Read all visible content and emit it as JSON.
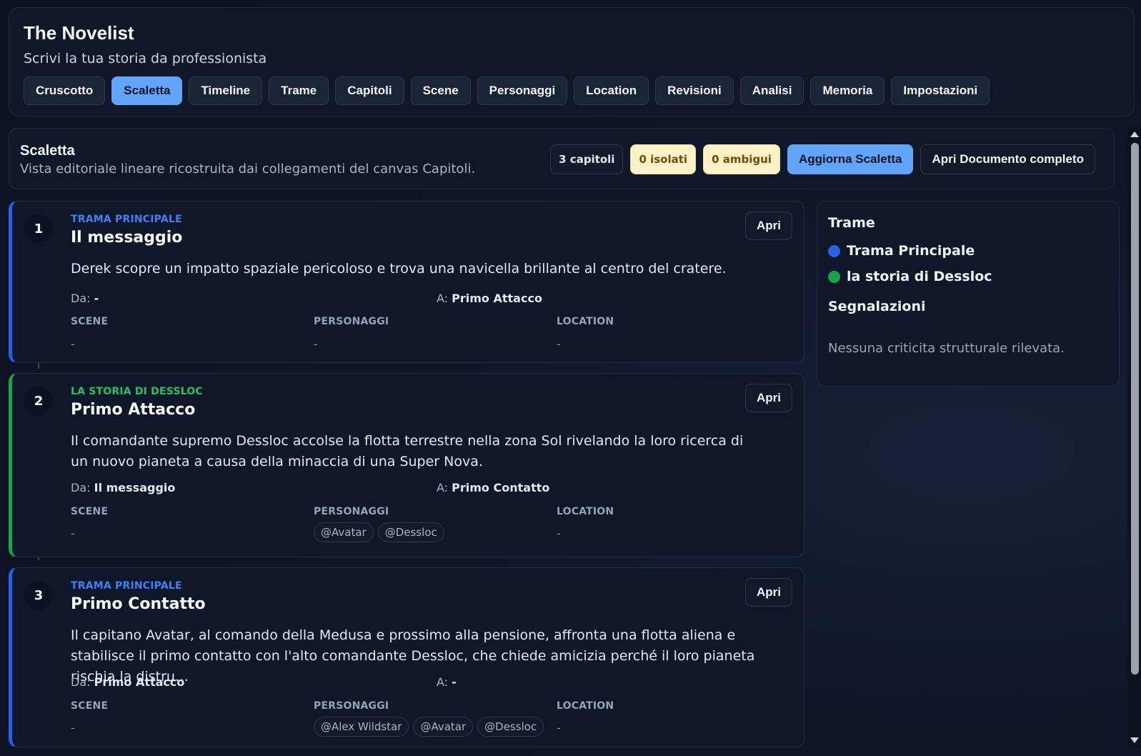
{
  "app": {
    "title": "The Novelist",
    "subtitle": "Scrivi la tua storia da professionista"
  },
  "nav": {
    "tabs": [
      "Cruscotto",
      "Scaletta",
      "Timeline",
      "Trame",
      "Capitoli",
      "Scene",
      "Personaggi",
      "Location",
      "Revisioni",
      "Analisi",
      "Memoria",
      "Impostazioni"
    ],
    "active": "Scaletta"
  },
  "toolbar": {
    "title": "Scaletta",
    "description": "Vista editoriale lineare ricostruita dai collegamenti del canvas Capitoli.",
    "chapters_badge": "3 capitoli",
    "isolated_badge": "0 isolati",
    "ambiguous_badge": "0 ambigui",
    "refresh_button": "Aggiorna Scaletta",
    "open_document_button": "Apri Documento completo"
  },
  "labels": {
    "from": "Da:",
    "to": "A:",
    "scenes": "SCENE",
    "characters": "PERSONAGGI",
    "location": "LOCATION",
    "open": "Apri",
    "empty": "-"
  },
  "chapters": [
    {
      "number": "1",
      "plot": "TRAMA PRINCIPALE",
      "title": "Il messaggio",
      "summary": "Derek scopre un impatto spaziale pericoloso e trova una navicella brillante al centro del cratere.",
      "from": "-",
      "to": "Primo Attacco",
      "scenes": "-",
      "characters": "-",
      "location": "-"
    },
    {
      "number": "2",
      "plot": "LA STORIA DI DESSLOC",
      "title": "Primo Attacco",
      "summary": "Il comandante supremo Dessloc accolse la flotta terrestre nella zona Sol rivelando la loro ricerca di un nuovo pianeta a causa della minaccia di una Super Nova.",
      "from": "Il messaggio",
      "to": "Primo Contatto",
      "scenes": "-",
      "character_tags": [
        "@Avatar",
        "@Dessloc"
      ],
      "location": "-"
    },
    {
      "number": "3",
      "plot": "TRAMA PRINCIPALE",
      "title": "Primo Contatto",
      "summary": "Il capitano Avatar, al comando della Medusa e prossimo alla pensione, affronta una flotta aliena e stabilisce il primo contatto con l'alto comandante Dessloc, che chiede amicizia perché il loro pianeta rischia la distru…",
      "from": "Primo Attacco",
      "to": "-",
      "scenes": "-",
      "character_tags": [
        "@Alex Wildstar",
        "@Avatar",
        "@Dessloc"
      ],
      "location": "-"
    }
  ],
  "sidebar": {
    "plots_title": "Trame",
    "plots": [
      {
        "name": "Trama Principale",
        "color": "#2563eb"
      },
      {
        "name": "la storia di Dessloc",
        "color": "#16a34a"
      }
    ],
    "alerts_title": "Segnalazioni",
    "alerts_note": "Nessuna criticita strutturale rilevata."
  }
}
